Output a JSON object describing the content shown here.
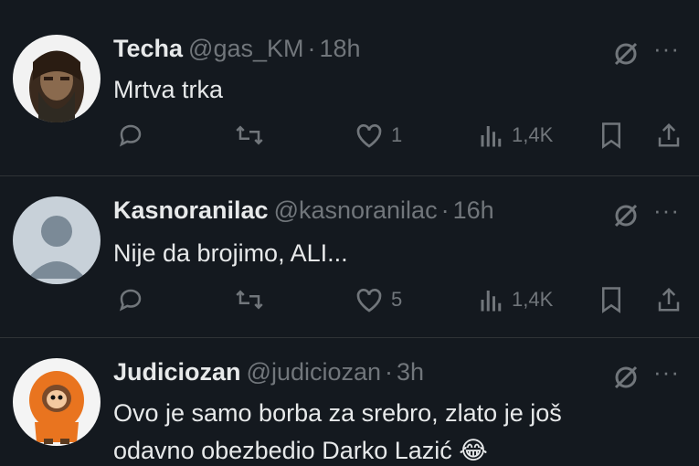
{
  "colors": {
    "background": "#14191f",
    "text_primary": "#e7e9ea",
    "text_secondary": "#71767b",
    "divider": "#2f3336"
  },
  "tweets": [
    {
      "name": "Techa",
      "handle": "@gas_KM",
      "dot": "·",
      "time": "18h",
      "text": "Mrtva trka",
      "reply_icon": "reply-icon",
      "repost_icon": "repost-icon",
      "like_icon": "like-icon",
      "likes": "1",
      "views": "1,4K",
      "avatar": "photo"
    },
    {
      "name": "Kasnoranilac",
      "handle": "@kasnoranilac",
      "dot": "·",
      "time": "16h",
      "text": "Nije da brojimo, ALI...",
      "reply_icon": "reply-icon",
      "repost_icon": "repost-icon",
      "like_icon": "like-icon",
      "likes": "5",
      "views": "1,4K",
      "avatar": "default"
    },
    {
      "name": "Judiciozan",
      "handle": "@judiciozan",
      "dot": "·",
      "time": "3h",
      "text_line1": "Ovo je samo borba za srebro, zlato je još",
      "text_line2": "odavno obezbedio Darko Lazić",
      "emoji": "😂",
      "avatar": "kenny"
    }
  ],
  "more_label": "···"
}
